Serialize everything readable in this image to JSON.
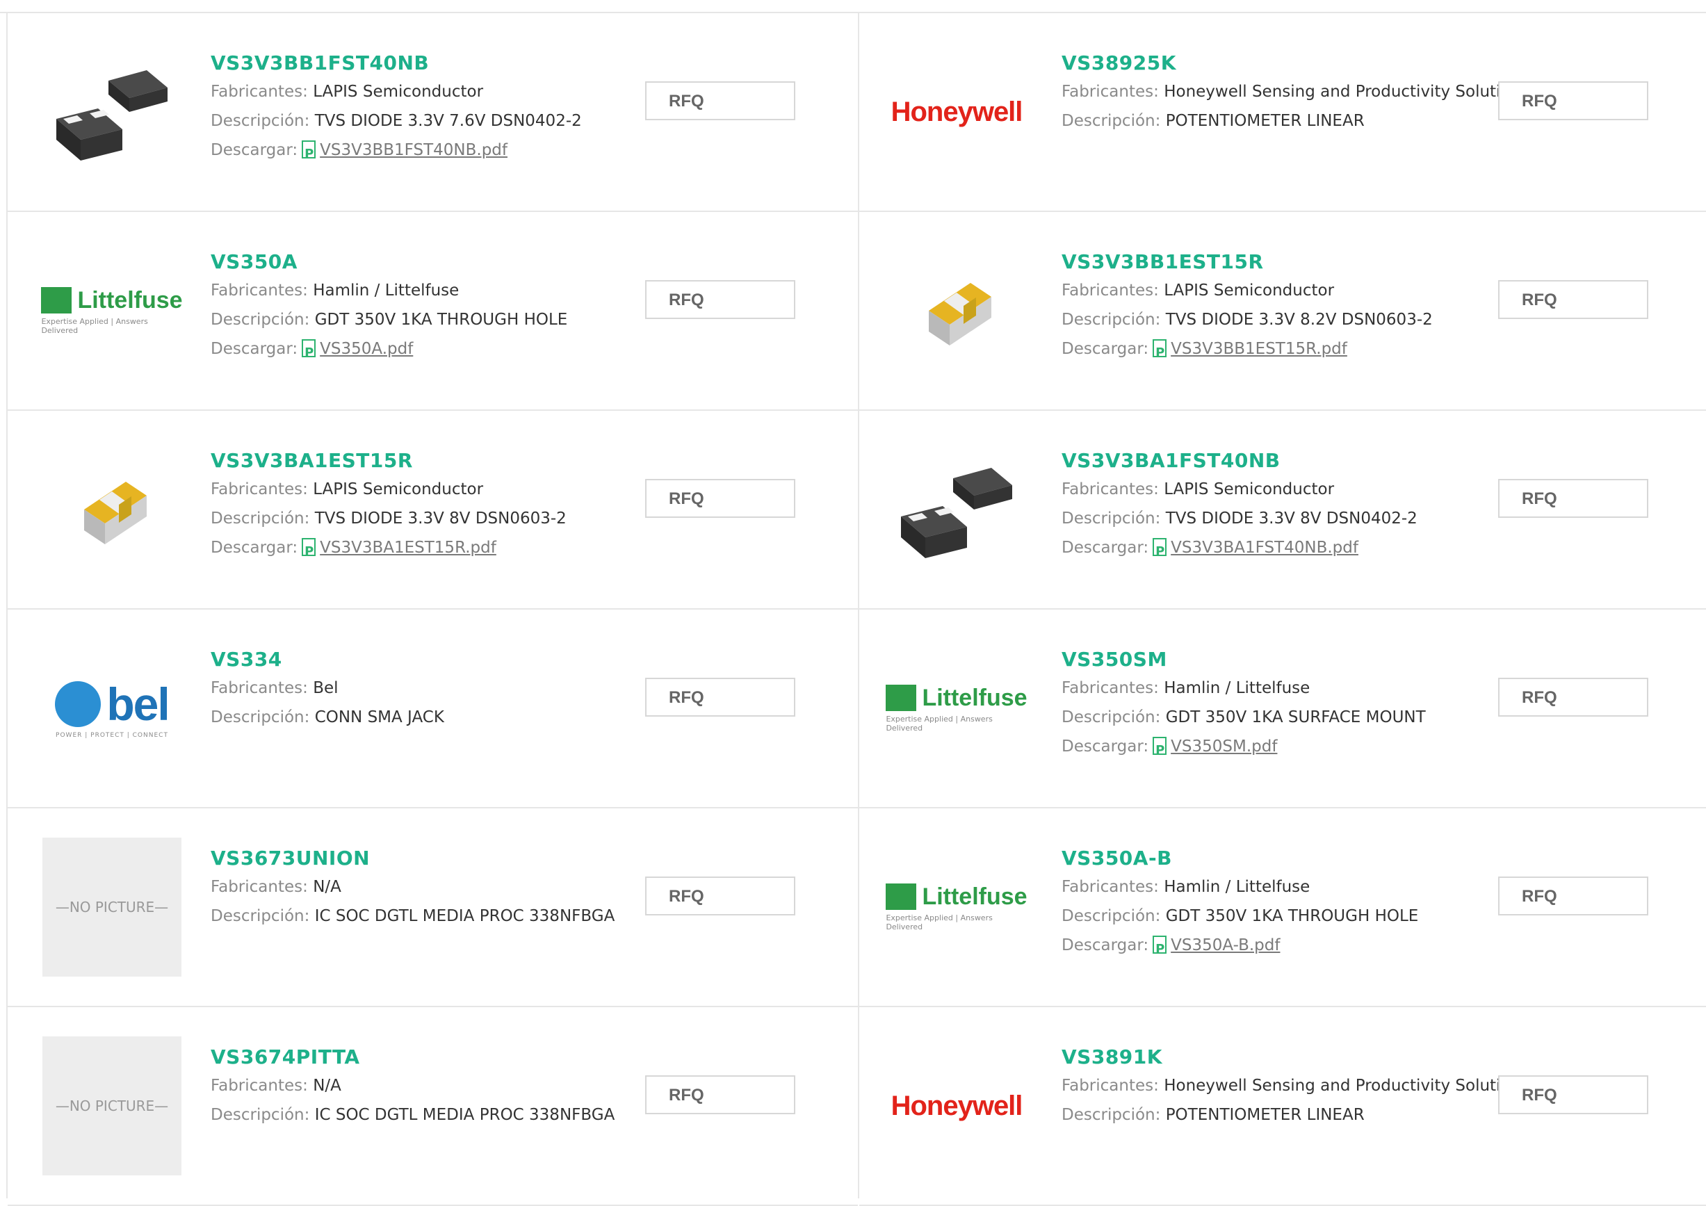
{
  "labels": {
    "manufacturer": "Fabricantes:",
    "description": "Descripción:",
    "download": "Descargar:",
    "rfq": "RFQ"
  },
  "thumbs": {
    "no_picture": "NO PICTURE",
    "honeywell": "Honeywell",
    "littelfuse": "Littelfuse",
    "littelfuse_tagline": "Expertise Applied | Answers Delivered",
    "bel": "bel",
    "bel_tagline": "POWER | PROTECT | CONNECT"
  },
  "products": [
    {
      "part": "VS3V3BB1FST40NB",
      "manufacturer": "LAPIS Semiconductor",
      "description": "TVS DIODE 3.3V 7.6V DSN0402-2",
      "pdf": "VS3V3BB1FST40NB.pdf",
      "image": "diode-dsn0402"
    },
    {
      "part": "VS38925K",
      "manufacturer": "Honeywell Sensing and Productivity Solutions",
      "description": "POTENTIOMETER LINEAR",
      "pdf": null,
      "image": "honeywell-logo"
    },
    {
      "part": "VS350A",
      "manufacturer": "Hamlin / Littelfuse",
      "description": "GDT 350V 1KA THROUGH HOLE",
      "pdf": "VS350A.pdf",
      "image": "littelfuse-logo"
    },
    {
      "part": "VS3V3BB1EST15R",
      "manufacturer": "LAPIS Semiconductor",
      "description": "TVS DIODE 3.3V 8.2V DSN0603-2",
      "pdf": "VS3V3BB1EST15R.pdf",
      "image": "diode-dsn0603"
    },
    {
      "part": "VS3V3BA1EST15R",
      "manufacturer": "LAPIS Semiconductor",
      "description": "TVS DIODE 3.3V 8V DSN0603-2",
      "pdf": "VS3V3BA1EST15R.pdf",
      "image": "diode-dsn0603"
    },
    {
      "part": "VS3V3BA1FST40NB",
      "manufacturer": "LAPIS Semiconductor",
      "description": "TVS DIODE 3.3V 8V DSN0402-2",
      "pdf": "VS3V3BA1FST40NB.pdf",
      "image": "diode-dsn0402"
    },
    {
      "part": "VS334",
      "manufacturer": "Bel",
      "description": "CONN SMA JACK",
      "pdf": null,
      "image": "bel-logo"
    },
    {
      "part": "VS350SM",
      "manufacturer": "Hamlin / Littelfuse",
      "description": "GDT 350V 1KA SURFACE MOUNT",
      "pdf": "VS350SM.pdf",
      "image": "littelfuse-logo"
    },
    {
      "part": "VS3673UNION",
      "manufacturer": "N/A",
      "description": "IC SOC DGTL MEDIA PROC 338NFBGA",
      "pdf": null,
      "image": "no-picture"
    },
    {
      "part": "VS350A-B",
      "manufacturer": "Hamlin / Littelfuse",
      "description": "GDT 350V 1KA THROUGH HOLE",
      "pdf": "VS350A-B.pdf",
      "image": "littelfuse-logo"
    },
    {
      "part": "VS3674PITTA",
      "manufacturer": "N/A",
      "description": "IC SOC DGTL MEDIA PROC 338NFBGA",
      "pdf": null,
      "image": "no-picture"
    },
    {
      "part": "VS3891K",
      "manufacturer": "Honeywell Sensing and Productivity Solutions",
      "description": "POTENTIOMETER LINEAR",
      "pdf": null,
      "image": "honeywell-logo"
    }
  ],
  "colors": {
    "part_link": "#1db08a",
    "honeywell_red": "#e2231a",
    "littelfuse_green": "#2e9c48",
    "bel_blue": "#1f73b7",
    "border": "#e6e6e6"
  }
}
